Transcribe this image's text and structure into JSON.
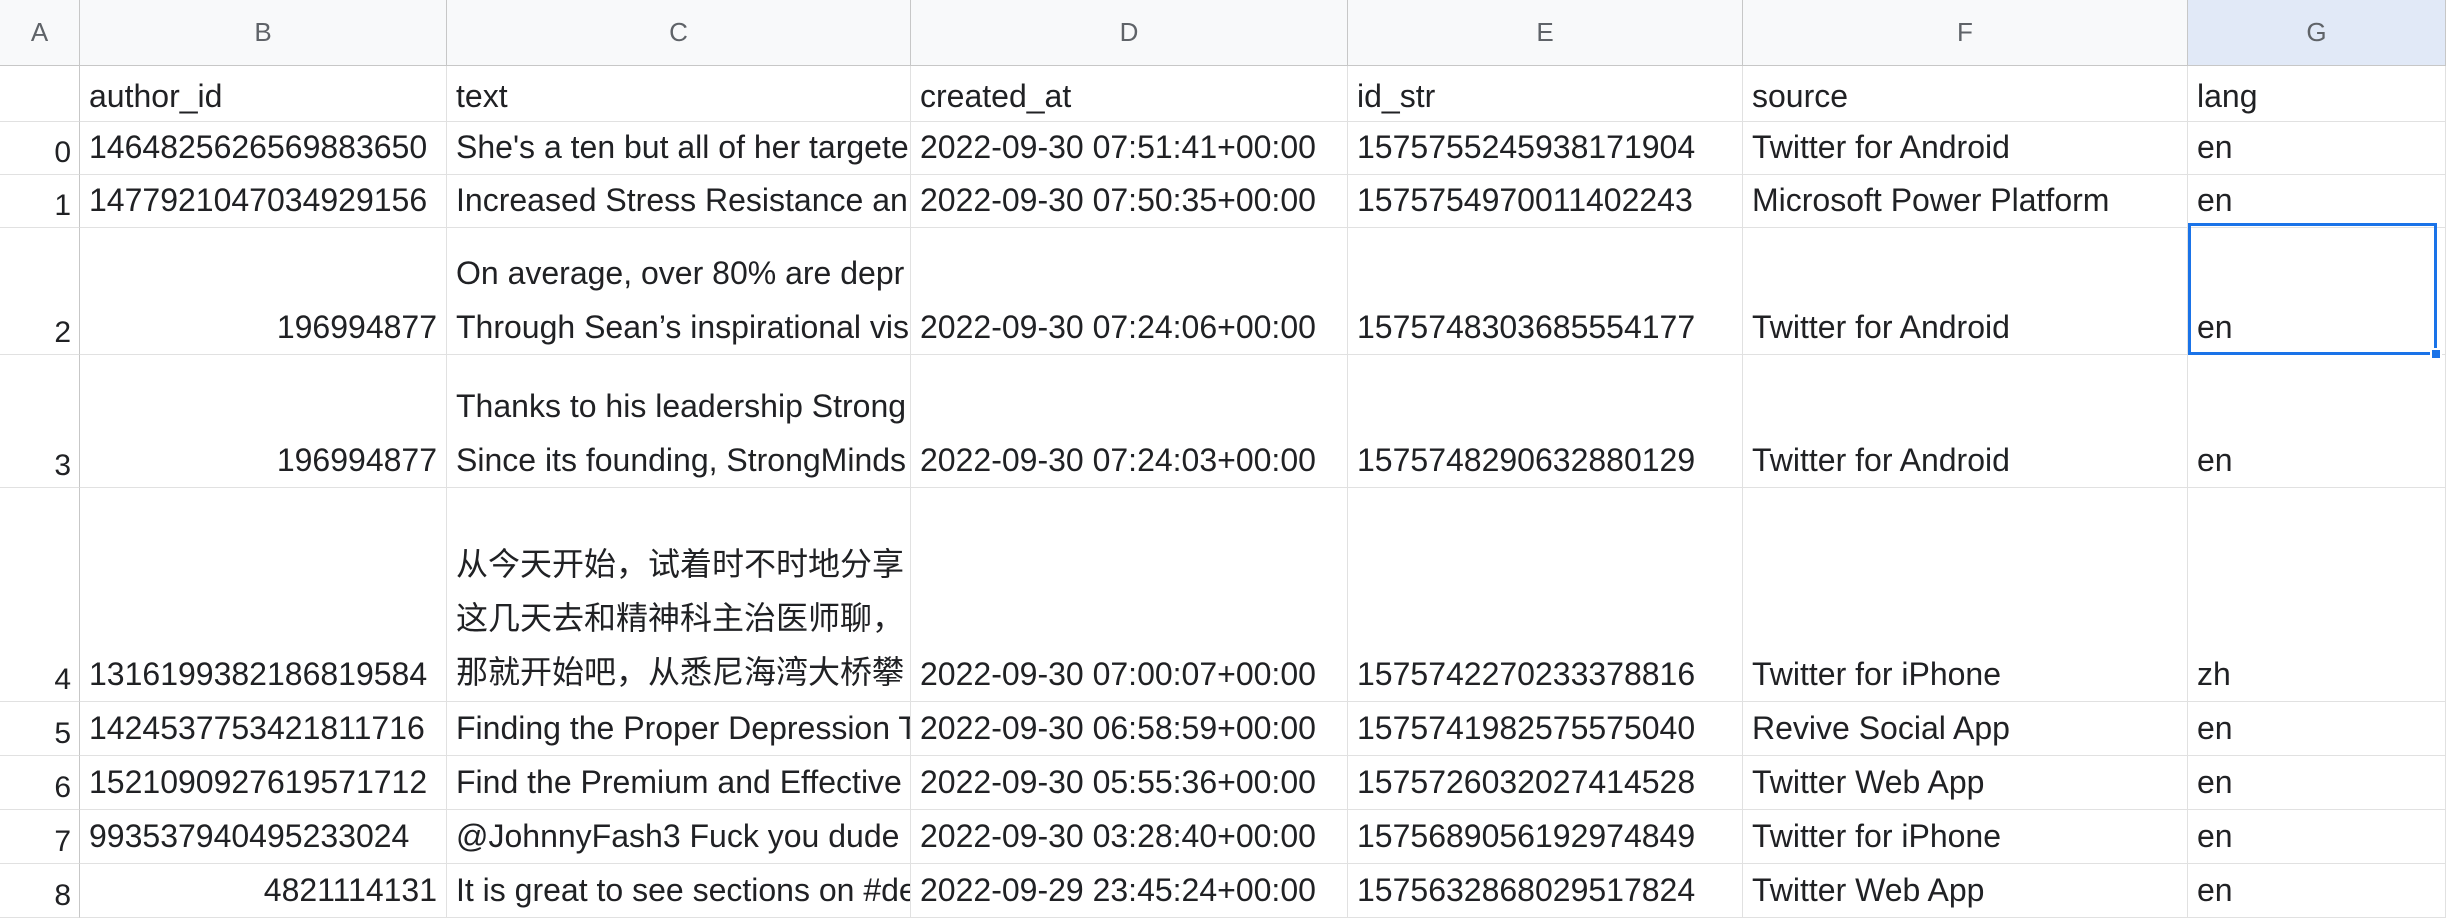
{
  "column_letters": [
    "A",
    "B",
    "C",
    "D",
    "E",
    "F",
    "G"
  ],
  "selected_column_letter": "G",
  "header_row": [
    "author_id",
    "text",
    "created_at",
    "id_str",
    "source",
    "lang"
  ],
  "rows": [
    {
      "index": "0",
      "author_id": "1464825626569883650",
      "text": [
        "She's a ten but all of her targete"
      ],
      "created_at": "2022-09-30 07:51:41+00:00",
      "id_str": "1575755245938171904",
      "source": "Twitter for Android",
      "lang": "en"
    },
    {
      "index": "1",
      "author_id": "1477921047034929156",
      "text": [
        "Increased Stress Resistance an"
      ],
      "created_at": "2022-09-30 07:50:35+00:00",
      "id_str": "1575754970011402243",
      "source": "Microsoft Power Platform",
      "lang": "en"
    },
    {
      "index": "2",
      "author_id": "196994877",
      "text": [
        "On average, over 80% are depr",
        "Through Sean’s inspirational vis"
      ],
      "created_at": "2022-09-30 07:24:06+00:00",
      "id_str": "1575748303685554177",
      "source": "Twitter for Android",
      "lang": "en"
    },
    {
      "index": "3",
      "author_id": "196994877",
      "text": [
        "Thanks to his leadership Strong",
        "Since its founding, StrongMinds"
      ],
      "created_at": "2022-09-30 07:24:03+00:00",
      "id_str": "1575748290632880129",
      "source": "Twitter for Android",
      "lang": "en"
    },
    {
      "index": "4",
      "author_id": "1316199382186819584",
      "text": [
        "从今天开始，试着时不时地分享",
        "这几天去和精神科主治医师聊，",
        "那就开始吧，从悉尼海湾大桥攀"
      ],
      "created_at": "2022-09-30 07:00:07+00:00",
      "id_str": "1575742270233378816",
      "source": "Twitter for iPhone",
      "lang": "zh"
    },
    {
      "index": "5",
      "author_id": "1424537753421811716",
      "text": [
        "Finding the Proper Depression T"
      ],
      "created_at": "2022-09-30 06:58:59+00:00",
      "id_str": "1575741982575575040",
      "source": "Revive Social App",
      "lang": "en"
    },
    {
      "index": "6",
      "author_id": "1521090927619571712",
      "text": [
        "Find the Premium and Effective"
      ],
      "created_at": "2022-09-30 05:55:36+00:00",
      "id_str": "1575726032027414528",
      "source": "Twitter Web App",
      "lang": "en"
    },
    {
      "index": "7",
      "author_id": "993537940495233024",
      "text": [
        "@JohnnyFash3 Fuck you dude"
      ],
      "created_at": "2022-09-30 03:28:40+00:00",
      "id_str": "1575689056192974849",
      "source": "Twitter for iPhone",
      "lang": "en"
    },
    {
      "index": "8",
      "author_id": "4821114131",
      "text": [
        "It is great to see sections on #de"
      ],
      "created_at": "2022-09-29 23:45:24+00:00",
      "id_str": "1575632868029517824",
      "source": "Twitter Web App",
      "lang": "en"
    }
  ],
  "colors": {
    "grid": "#e1e1e1",
    "header_bg": "#f8f9fa",
    "selected_header_bg": "#e1e9f7",
    "selection": "#1a73e8"
  }
}
